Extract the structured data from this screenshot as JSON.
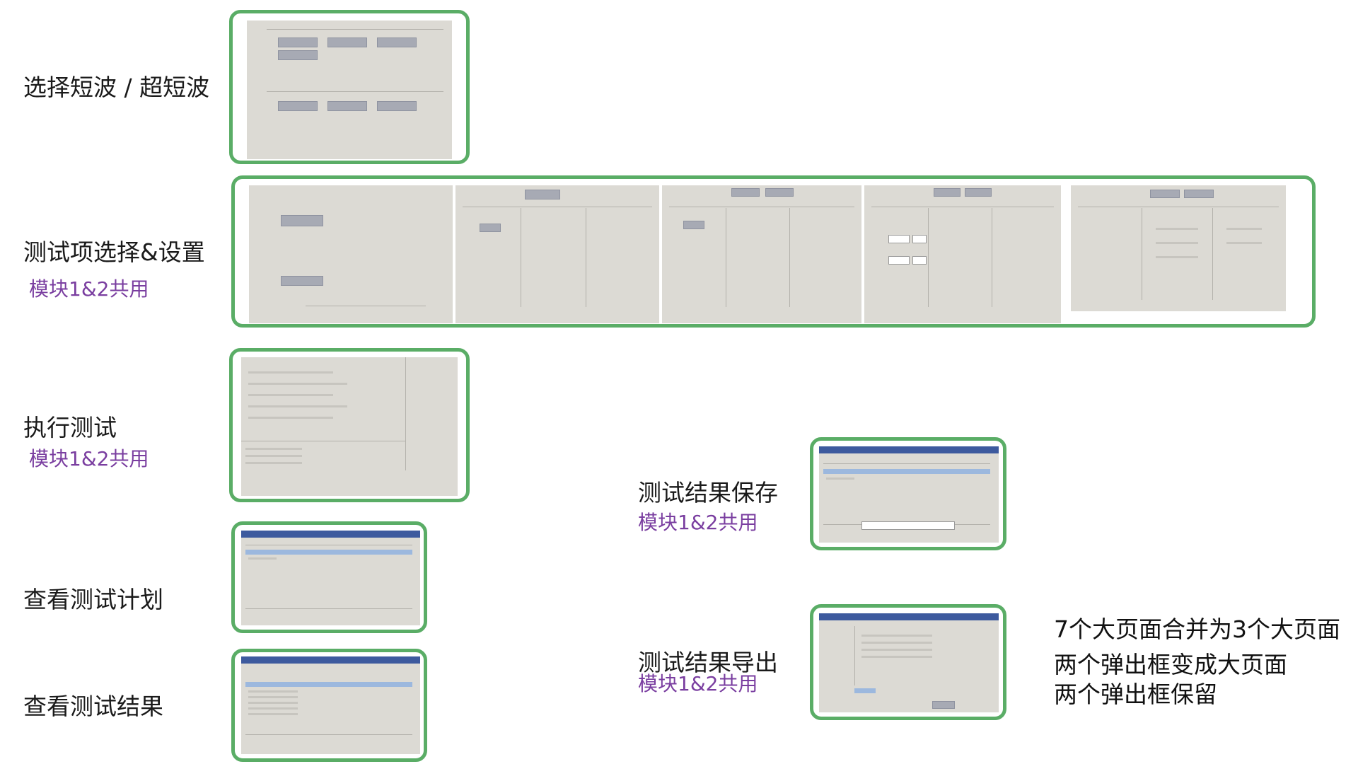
{
  "labels": {
    "select_wave": "选择短波 / 超短波",
    "test_item": "测试项选择&设置",
    "execute": "执行测试",
    "view_plan": "查看测试计划",
    "view_result": "查看测试结果",
    "save_result": "测试结果保存",
    "export_result": "测试结果导出"
  },
  "subs": {
    "test_item": "模块1&2共用",
    "execute": "模块1&2共用",
    "save_result": "模块1&2共用",
    "export_result": "模块1&2共用"
  },
  "notes": [
    "7个大页面合并为3个大页面",
    "两个弹出框变成大页面",
    "两个弹出框保留"
  ],
  "colors": {
    "frame": "#5aad66",
    "sub_text": "#7a3ea0"
  }
}
